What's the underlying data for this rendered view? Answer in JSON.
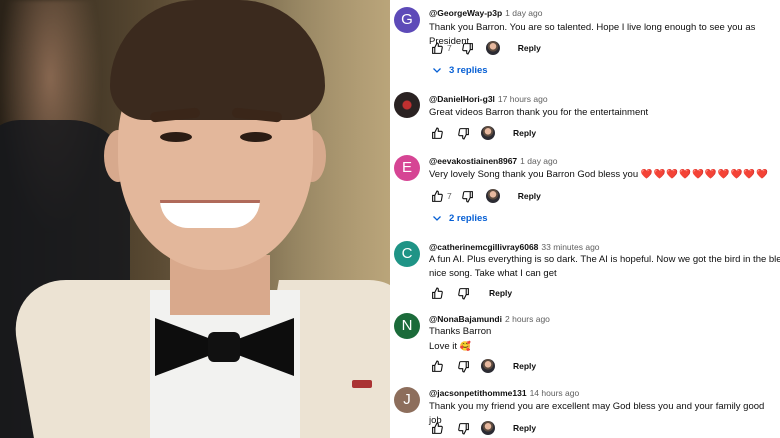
{
  "colors": {
    "link_blue": "#065fd4",
    "text_primary": "#0f0f0f",
    "text_secondary": "#606060",
    "heart_red": "#e0245e"
  },
  "comments": [
    {
      "avatar_letter": "G",
      "avatar_color": "#5d4ab8",
      "handle": "@GeorgeWay-p3p",
      "time": "1 day ago",
      "text": "Thank you Barron. You are so talented. Hope I live long enough to see you as President.",
      "likes": "7",
      "reply_label": "Reply",
      "replies_label": "3 replies",
      "creator_heart": true
    },
    {
      "avatar_letter": "",
      "avatar_color": "#3a2a2a",
      "handle": "@DanielHori-g3l",
      "time": "17 hours ago",
      "text": "Great videos Barron thank you for the entertainment",
      "likes": "",
      "reply_label": "Reply",
      "creator_heart": true
    },
    {
      "avatar_letter": "E",
      "avatar_color": "#d64594",
      "handle": "@eevakostiainen8967",
      "time": "1 day ago",
      "text": "Very lovely Song thank you Barron God bless you",
      "text_emoji": "❤️❤️❤️❤️❤️❤️❤️❤️❤️❤️",
      "likes": "7",
      "reply_label": "Reply",
      "replies_label": "2 replies",
      "creator_heart": true
    },
    {
      "avatar_letter": "C",
      "avatar_color": "#1f9486",
      "handle": "@catherinemcgillivray6068",
      "time": "33 minutes ago",
      "text_line1": "A fun AI. Plus everything is so dark.  The AI is hopeful. Now we got the bird in the blender",
      "text_line2": "nice song.  Take what I can get",
      "likes": "",
      "reply_label": "Reply",
      "creator_heart": false
    },
    {
      "avatar_letter": "N",
      "avatar_color": "#1b6b3a",
      "handle": "@NonaBajamundi",
      "time": "2 hours ago",
      "text_line1": "Thanks Barron",
      "text_line2": "Love it",
      "text_emoji": "🥰",
      "likes": "",
      "reply_label": "Reply",
      "creator_heart": true
    },
    {
      "avatar_letter": "J",
      "avatar_color": "#8d6e5c",
      "handle": "@jacsonpetithomme131",
      "time": "14 hours ago",
      "text": "Thank you my friend you are excellent may God bless you and your family good job",
      "likes": "",
      "reply_label": "Reply",
      "creator_heart": true
    }
  ]
}
